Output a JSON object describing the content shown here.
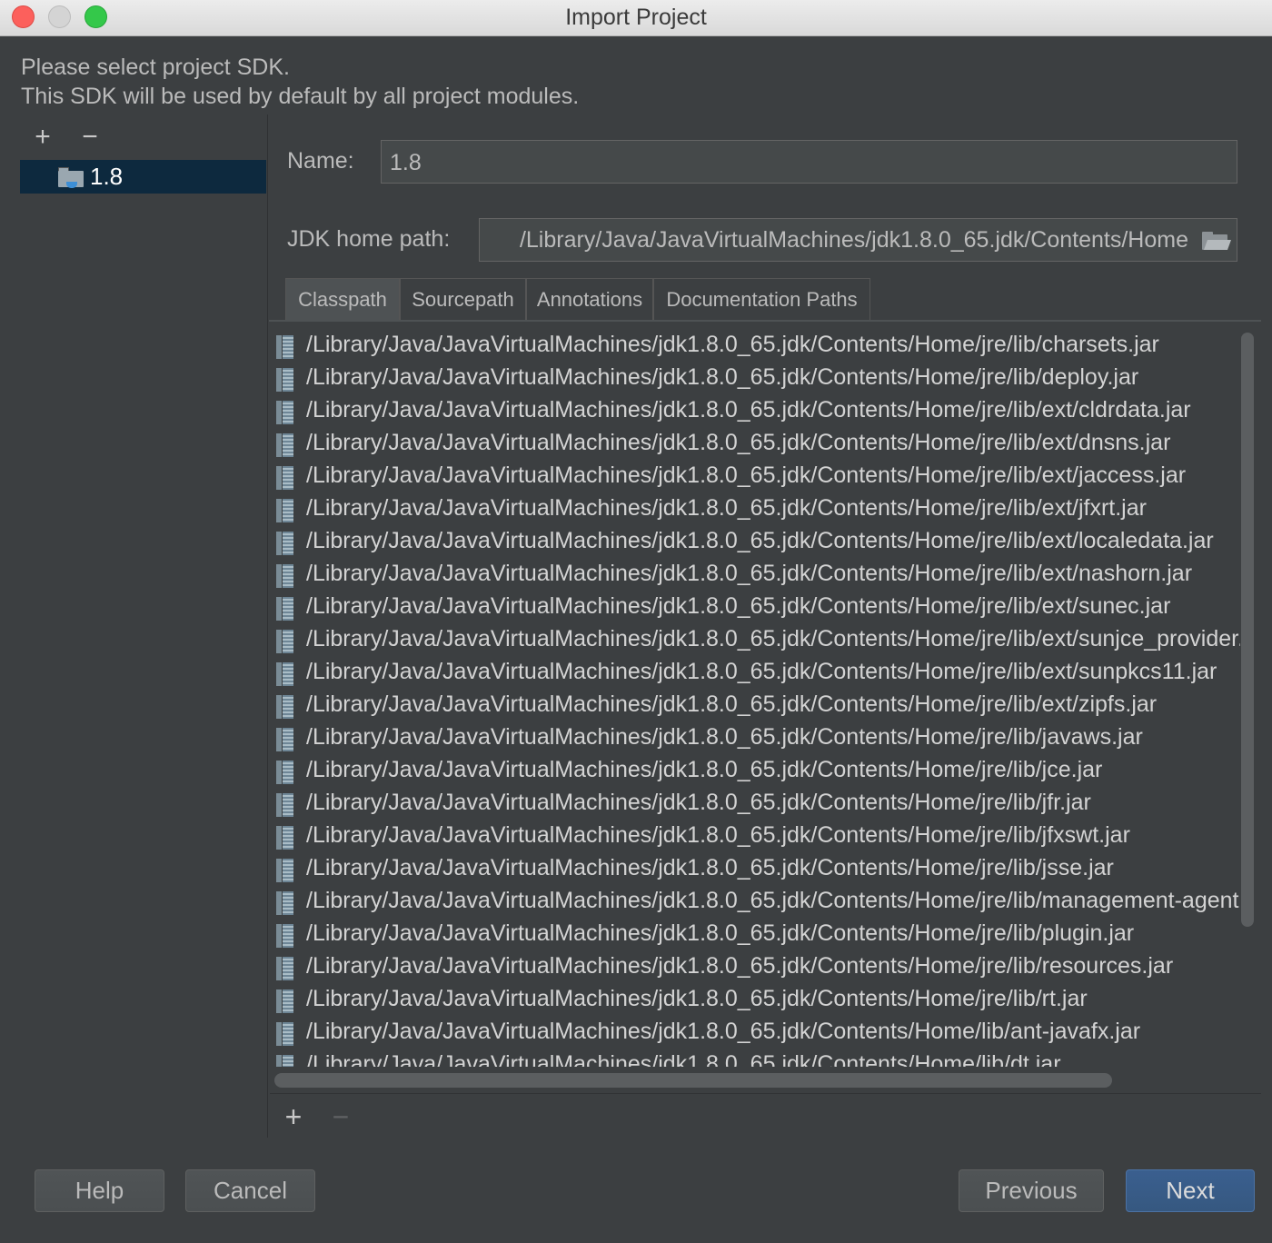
{
  "window": {
    "title": "Import Project"
  },
  "intro": {
    "line1": "Please select project SDK.",
    "line2": "This SDK will be used by default by all project modules."
  },
  "sdk_toolbar": {
    "add": "+",
    "remove": "−"
  },
  "sdk_list": [
    {
      "label": "1.8",
      "icon": "jdk-folder-icon",
      "selected": true
    }
  ],
  "form": {
    "name_label": "Name:",
    "name_value": "1.8",
    "jdk_label": "JDK home path:",
    "jdk_value": "/Library/Java/JavaVirtualMachines/jdk1.8.0_65.jdk/Contents/Home"
  },
  "tabs": [
    {
      "label": "Classpath",
      "active": true
    },
    {
      "label": "Sourcepath",
      "active": false
    },
    {
      "label": "Annotations",
      "active": false
    },
    {
      "label": "Documentation Paths",
      "active": false
    }
  ],
  "classpath": [
    "/Library/Java/JavaVirtualMachines/jdk1.8.0_65.jdk/Contents/Home/jre/lib/charsets.jar",
    "/Library/Java/JavaVirtualMachines/jdk1.8.0_65.jdk/Contents/Home/jre/lib/deploy.jar",
    "/Library/Java/JavaVirtualMachines/jdk1.8.0_65.jdk/Contents/Home/jre/lib/ext/cldrdata.jar",
    "/Library/Java/JavaVirtualMachines/jdk1.8.0_65.jdk/Contents/Home/jre/lib/ext/dnsns.jar",
    "/Library/Java/JavaVirtualMachines/jdk1.8.0_65.jdk/Contents/Home/jre/lib/ext/jaccess.jar",
    "/Library/Java/JavaVirtualMachines/jdk1.8.0_65.jdk/Contents/Home/jre/lib/ext/jfxrt.jar",
    "/Library/Java/JavaVirtualMachines/jdk1.8.0_65.jdk/Contents/Home/jre/lib/ext/localedata.jar",
    "/Library/Java/JavaVirtualMachines/jdk1.8.0_65.jdk/Contents/Home/jre/lib/ext/nashorn.jar",
    "/Library/Java/JavaVirtualMachines/jdk1.8.0_65.jdk/Contents/Home/jre/lib/ext/sunec.jar",
    "/Library/Java/JavaVirtualMachines/jdk1.8.0_65.jdk/Contents/Home/jre/lib/ext/sunjce_provider.jar",
    "/Library/Java/JavaVirtualMachines/jdk1.8.0_65.jdk/Contents/Home/jre/lib/ext/sunpkcs11.jar",
    "/Library/Java/JavaVirtualMachines/jdk1.8.0_65.jdk/Contents/Home/jre/lib/ext/zipfs.jar",
    "/Library/Java/JavaVirtualMachines/jdk1.8.0_65.jdk/Contents/Home/jre/lib/javaws.jar",
    "/Library/Java/JavaVirtualMachines/jdk1.8.0_65.jdk/Contents/Home/jre/lib/jce.jar",
    "/Library/Java/JavaVirtualMachines/jdk1.8.0_65.jdk/Contents/Home/jre/lib/jfr.jar",
    "/Library/Java/JavaVirtualMachines/jdk1.8.0_65.jdk/Contents/Home/jre/lib/jfxswt.jar",
    "/Library/Java/JavaVirtualMachines/jdk1.8.0_65.jdk/Contents/Home/jre/lib/jsse.jar",
    "/Library/Java/JavaVirtualMachines/jdk1.8.0_65.jdk/Contents/Home/jre/lib/management-agent.jar",
    "/Library/Java/JavaVirtualMachines/jdk1.8.0_65.jdk/Contents/Home/jre/lib/plugin.jar",
    "/Library/Java/JavaVirtualMachines/jdk1.8.0_65.jdk/Contents/Home/jre/lib/resources.jar",
    "/Library/Java/JavaVirtualMachines/jdk1.8.0_65.jdk/Contents/Home/jre/lib/rt.jar",
    "/Library/Java/JavaVirtualMachines/jdk1.8.0_65.jdk/Contents/Home/lib/ant-javafx.jar",
    "/Library/Java/JavaVirtualMachines/jdk1.8.0_65.jdk/Contents/Home/lib/dt.jar"
  ],
  "list_toolbar": {
    "add": "+",
    "remove": "−"
  },
  "buttons": {
    "help": "Help",
    "cancel": "Cancel",
    "previous": "Previous",
    "next": "Next"
  },
  "colors": {
    "background": "#3c3f41",
    "selection": "#0d293e",
    "primary_button": "#365880"
  }
}
